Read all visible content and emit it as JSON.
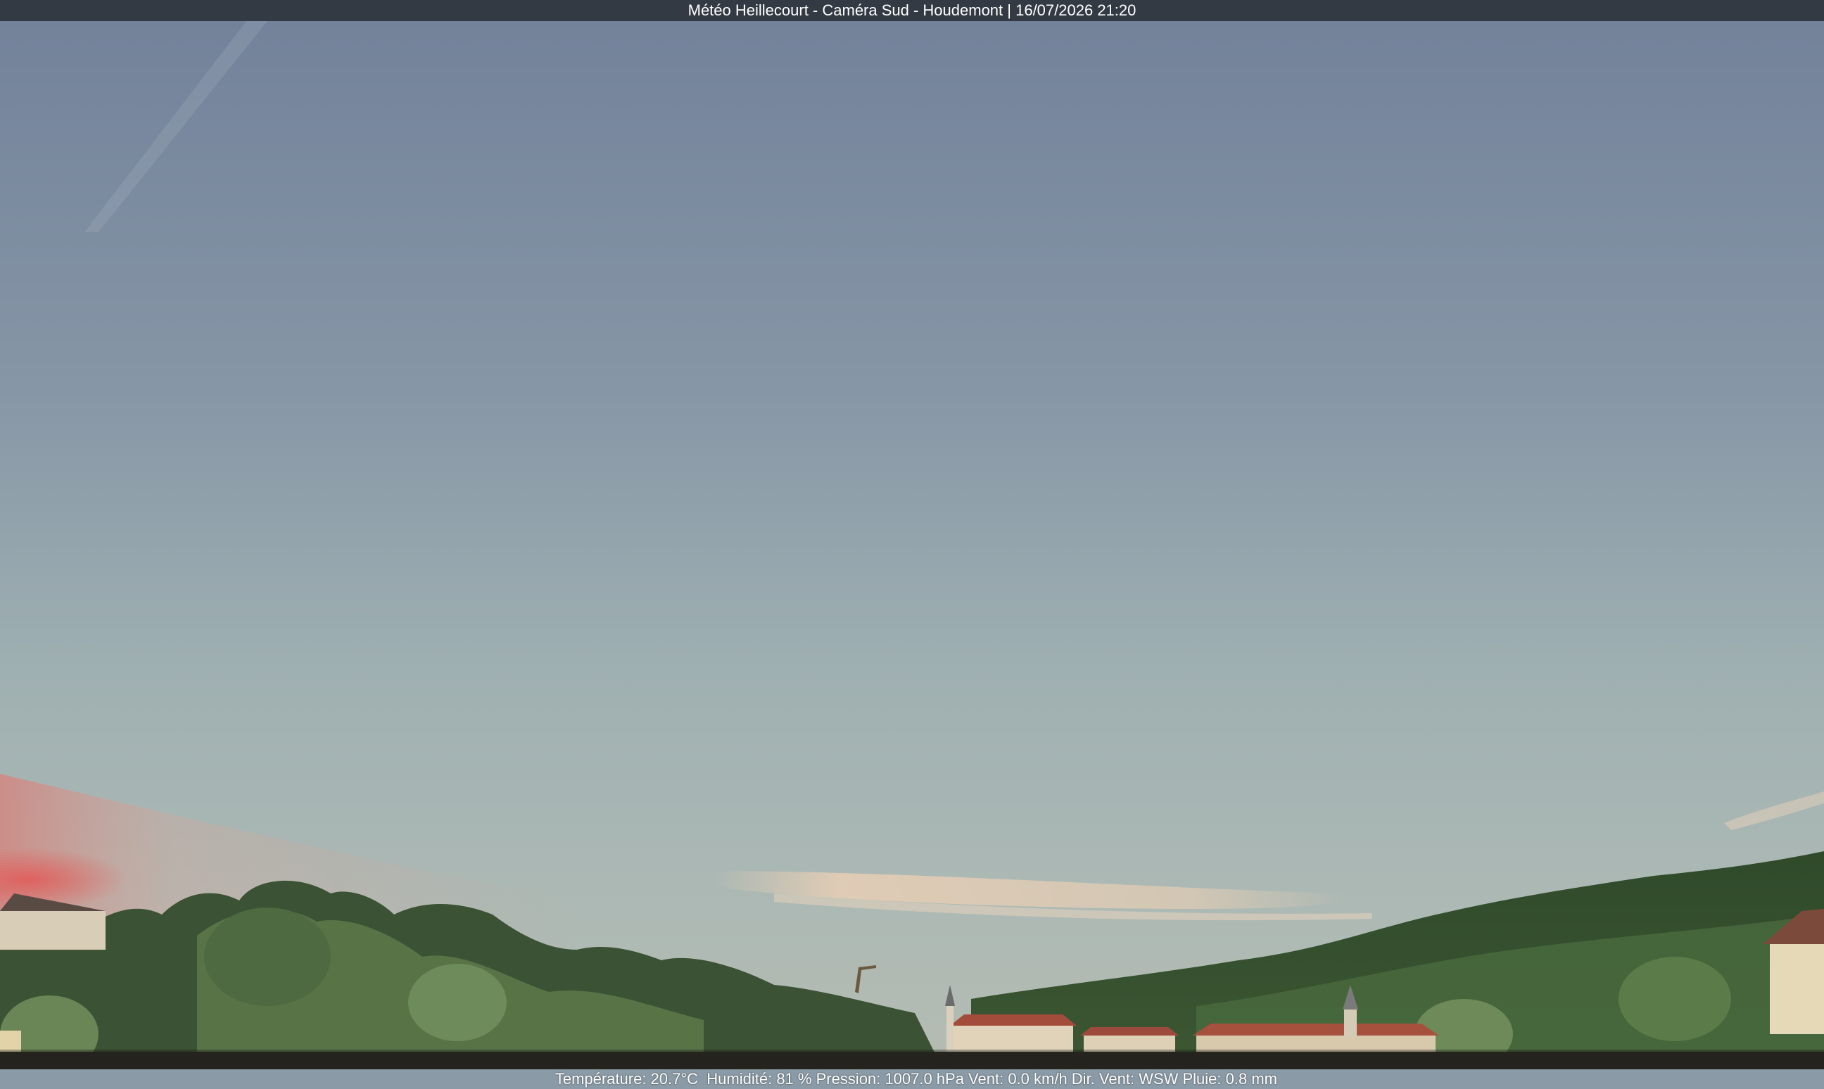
{
  "header": {
    "title": "Météo Heillecourt - Caméra Sud - Houdemont | 16/07/2026 21:20"
  },
  "footer": {
    "readout": "Température: 20.7°C  Humidité: 81 % Pression: 1007.0 hPa Vent: 0.0 km/h Dir. Vent: WSW Pluie: 0.8 mm"
  },
  "scene": {
    "colors": {
      "sky_top": "#75849a",
      "sky_mid": "#8e9eaa",
      "sky_low": "#a8b6b5",
      "horizon_glow": "#e7b79f",
      "sunset_pink": "#e0635f",
      "trees_dark": "#2a3a28",
      "trees_mid": "#4a6540",
      "trees_light": "#6f8a5c",
      "roofs": "#a24a3a",
      "walls": "#e3d6bd"
    }
  }
}
